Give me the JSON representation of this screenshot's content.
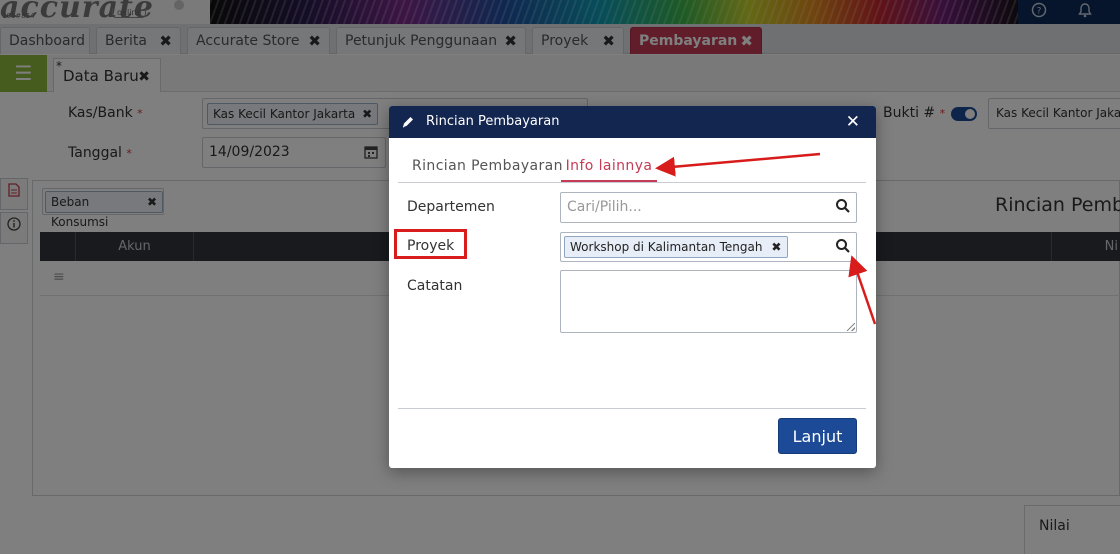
{
  "app": {
    "logo_text": "accurate",
    "logo_sub": "101#854",
    "logo_online": "online"
  },
  "tabs": [
    {
      "label": "Dashboard"
    },
    {
      "label": "Berita"
    },
    {
      "label": "Accurate Store"
    },
    {
      "label": "Petunjuk Penggunaan"
    },
    {
      "label": "Proyek"
    },
    {
      "label": "Pembayaran",
      "active": true
    }
  ],
  "icons": {
    "close": "✖",
    "menu": "☰",
    "search": "search-icon",
    "calendar": "calendar-icon",
    "pencil": "pencil-icon",
    "help": "help-icon",
    "bell": "bell-icon",
    "document": "document-icon",
    "info": "info-icon"
  },
  "subtab": {
    "label": "Data Baru",
    "modified_marker": "*"
  },
  "form": {
    "kas_bank_label": "Kas/Bank",
    "kas_bank_value": "Kas Kecil Kantor Jakarta",
    "tanggal_label": "Tanggal",
    "tanggal_value": "14/09/2023",
    "required_marker": "*",
    "bukti_label": "Bukti #",
    "bukti_value": "Kas Kecil Kantor Jakarta",
    "akun_filter_chip": "Beban Konsumsi",
    "section_title": "Rincian Pemba",
    "grid_col_akun": "Akun",
    "grid_col_ni": "Ni",
    "nilai_label": "Nilai",
    "row_handle": "≡"
  },
  "modal": {
    "title": "Rincian Pembayaran",
    "close": "✕",
    "tabs": [
      {
        "label": "Rincian Pembayaran"
      },
      {
        "label": "Info lainnya",
        "active": true
      }
    ],
    "departemen_label": "Departemen",
    "departemen_placeholder": "Cari/Pilih...",
    "proyek_label": "Proyek",
    "proyek_value": "Workshop di Kalimantan Tengah",
    "catatan_label": "Catatan",
    "catatan_value": "",
    "lanjut_button": "Lanjut"
  },
  "colors": {
    "accent_active_tab": "#c53b55",
    "modal_header": "#13264f",
    "primary_button": "#1c4a96",
    "annotation_red": "#d81b1b",
    "menu_green": "#8bb83d"
  }
}
